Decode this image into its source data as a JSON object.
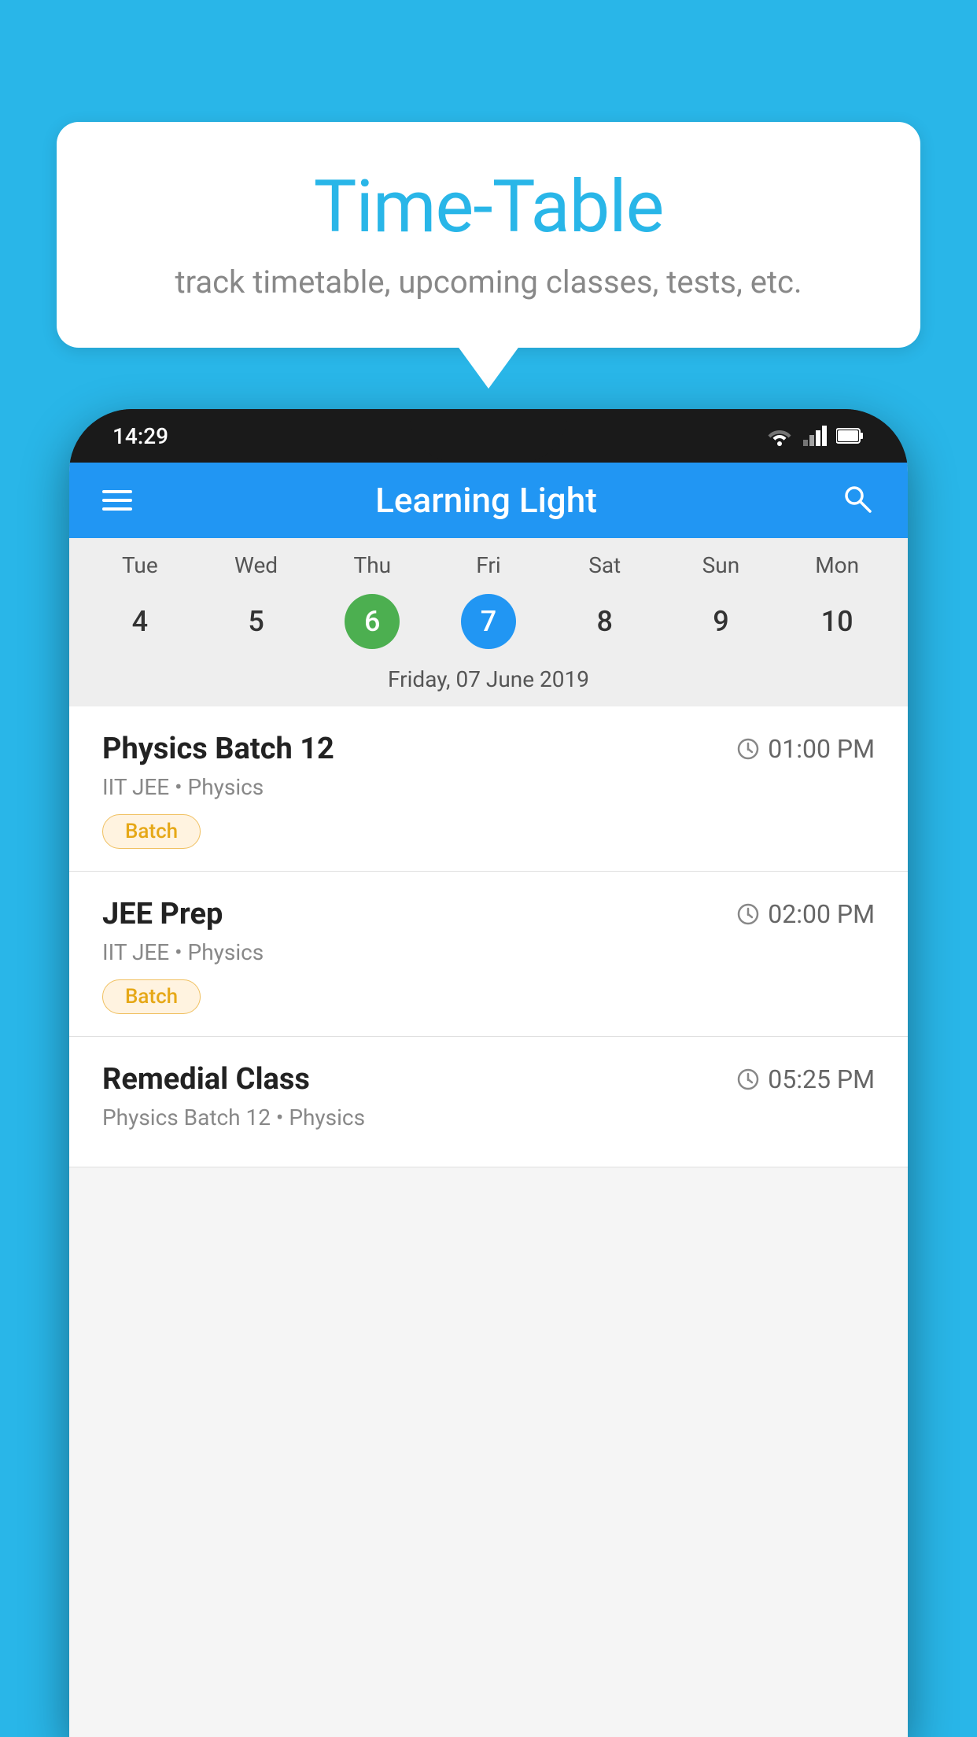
{
  "background": {
    "color": "#29b6e8"
  },
  "speech_bubble": {
    "title": "Time-Table",
    "subtitle": "track timetable, upcoming classes, tests, etc."
  },
  "phone": {
    "status_bar": {
      "time": "14:29"
    },
    "app_header": {
      "title": "Learning Light"
    },
    "calendar": {
      "days": [
        "Tue",
        "Wed",
        "Thu",
        "Fri",
        "Sat",
        "Sun",
        "Mon"
      ],
      "dates": [
        "4",
        "5",
        "6",
        "7",
        "8",
        "9",
        "10"
      ],
      "today_index": 2,
      "selected_index": 3,
      "selected_label": "Friday, 07 June 2019"
    },
    "schedule": [
      {
        "name": "Physics Batch 12",
        "time": "01:00 PM",
        "sub": "IIT JEE • Physics",
        "badge": "Batch"
      },
      {
        "name": "JEE Prep",
        "time": "02:00 PM",
        "sub": "IIT JEE • Physics",
        "badge": "Batch"
      },
      {
        "name": "Remedial Class",
        "time": "05:25 PM",
        "sub": "Physics Batch 12 • Physics",
        "badge": null
      }
    ]
  }
}
